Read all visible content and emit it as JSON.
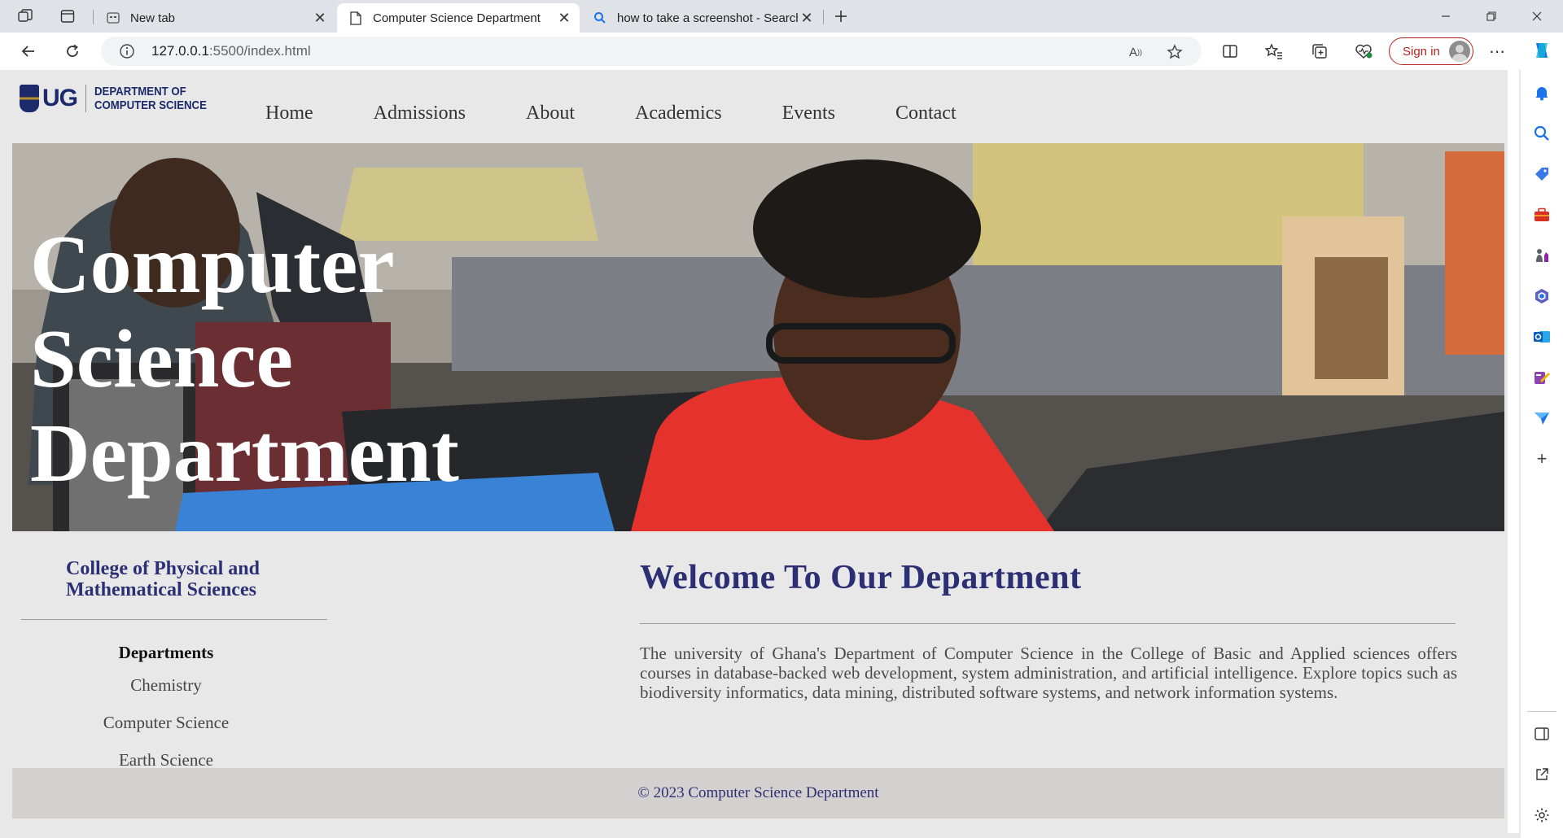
{
  "browser": {
    "tabs": [
      {
        "label": "New tab",
        "icon": "new-tab-page-icon"
      },
      {
        "label": "Computer Science Department",
        "icon": "document-icon"
      },
      {
        "label": "how to take a screenshot - Search",
        "icon": "search-icon"
      }
    ],
    "address": {
      "host": "127.0.0.1",
      "path": ":5500/index.html"
    },
    "sign_in_label": "Sign in"
  },
  "site": {
    "logo": {
      "mark": "UG",
      "line1": "DEPARTMENT OF",
      "line2": "COMPUTER SCIENCE"
    },
    "nav": [
      "Home",
      "Admissions",
      "About",
      "Academics",
      "Events",
      "Contact"
    ],
    "hero": {
      "line1": "Computer",
      "line2": "Science",
      "line3": "Department"
    },
    "sidebar": {
      "college": "College of Physical and Mathematical Sciences",
      "departments_heading": "Departments",
      "departments": [
        "Chemistry",
        "Computer Science",
        "Earth Science"
      ]
    },
    "main": {
      "heading": "Welcome To Our Department",
      "intro": "The university of Ghana's Department of Computer Science in the College of Basic and Applied sciences offers courses in database-backed web development, system administration, and artificial intelligence. Explore topics such as biodiversity informatics, data mining, distributed software systems, and network information systems."
    },
    "footer": "© 2023 Computer Science Department"
  },
  "colors": {
    "brand_navy": "#2c2f73",
    "signin_red": "#b3261e",
    "edge_accent": "#1a73e8"
  }
}
